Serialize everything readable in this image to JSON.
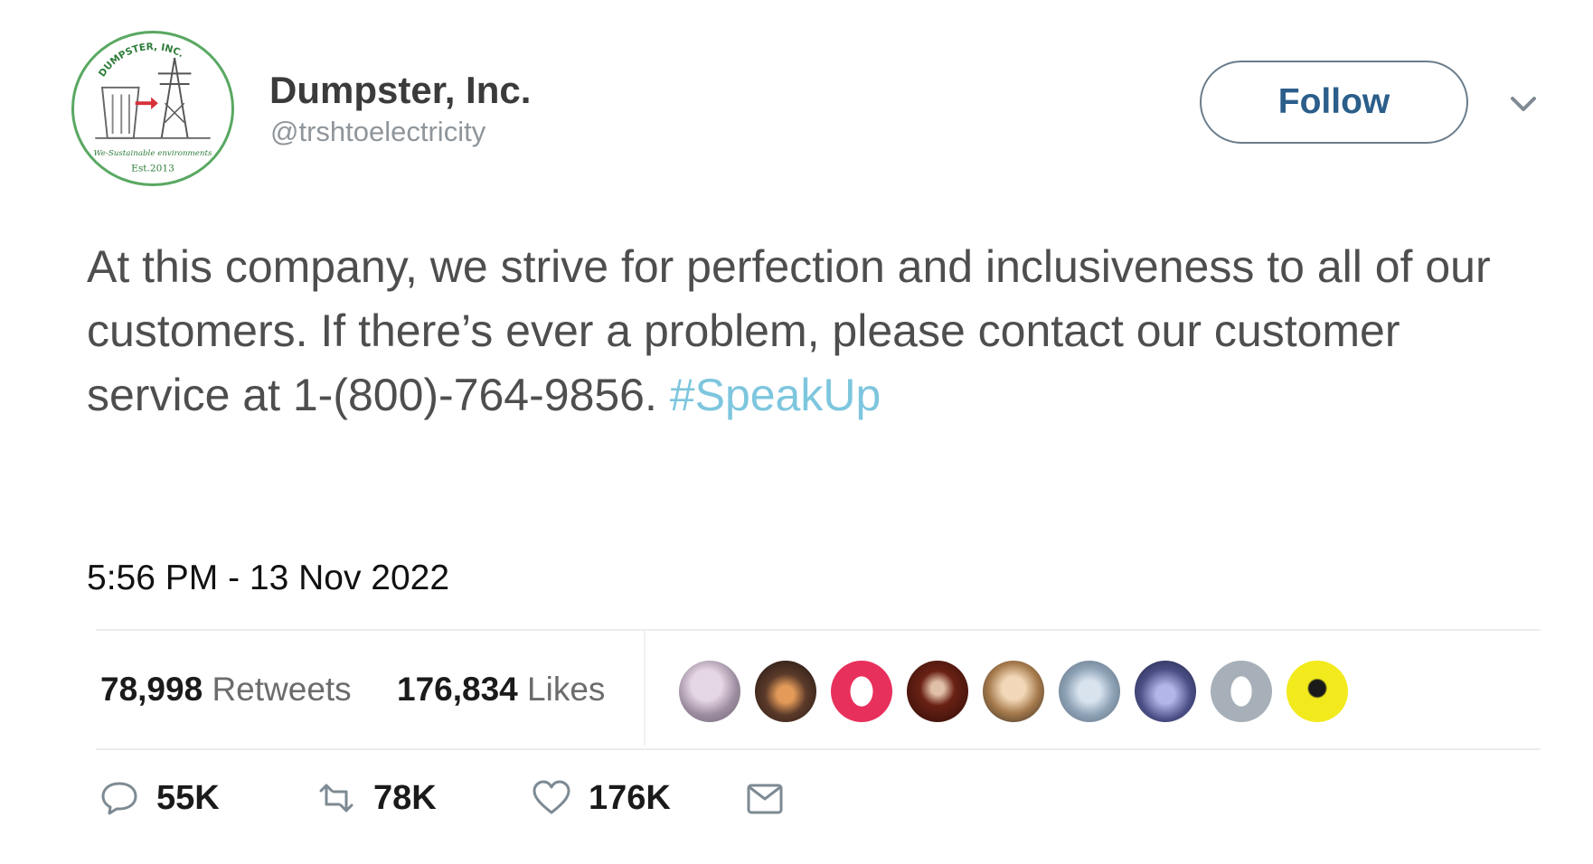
{
  "account": {
    "name": "Dumpster, Inc.",
    "handle": "@trshtoelectricity",
    "avatar": {
      "top_text": "DUMPSTER, INC.",
      "middle_text": "We-Sustainable environments",
      "bottom_text": "Est.2013",
      "border_color": "#59a862"
    }
  },
  "follow_button": {
    "label": "Follow"
  },
  "tweet": {
    "lines": [
      "At this company, we strive for perfection and inclusiveness to all of our",
      "customers. If there’s ever a problem, please contact our customer",
      "service at 1-(800)-764-9856. "
    ],
    "hashtag": "#SpeakUp",
    "hashtag_color": "#7dc6de",
    "timestamp": "5:56 PM - 13 Nov 2022"
  },
  "stats": {
    "retweets": {
      "count": "78,998",
      "label": "Retweets"
    },
    "likes": {
      "count": "176,834",
      "label": "Likes"
    }
  },
  "likers": [
    {
      "icon": "user-avatar-1",
      "color": "#b9a7b8"
    },
    {
      "icon": "user-avatar-2",
      "color": "#6b3b24"
    },
    {
      "icon": "user-avatar-3",
      "color": "#e8305c"
    },
    {
      "icon": "user-avatar-4",
      "color": "#5a1b12"
    },
    {
      "icon": "user-avatar-5",
      "color": "#c9a27a"
    },
    {
      "icon": "user-avatar-6",
      "color": "#8fa1b3"
    },
    {
      "icon": "user-avatar-7",
      "color": "#4b4f86"
    },
    {
      "icon": "user-avatar-8",
      "color": "#a7b0b8"
    },
    {
      "icon": "user-avatar-9",
      "color": "#f2ea1c"
    }
  ],
  "actions": {
    "reply": {
      "icon": "reply-icon",
      "count": "55K"
    },
    "retweet": {
      "icon": "retweet-icon",
      "count": "78K"
    },
    "like": {
      "icon": "heart-icon",
      "count": "176K"
    },
    "message": {
      "icon": "envelope-icon"
    }
  }
}
